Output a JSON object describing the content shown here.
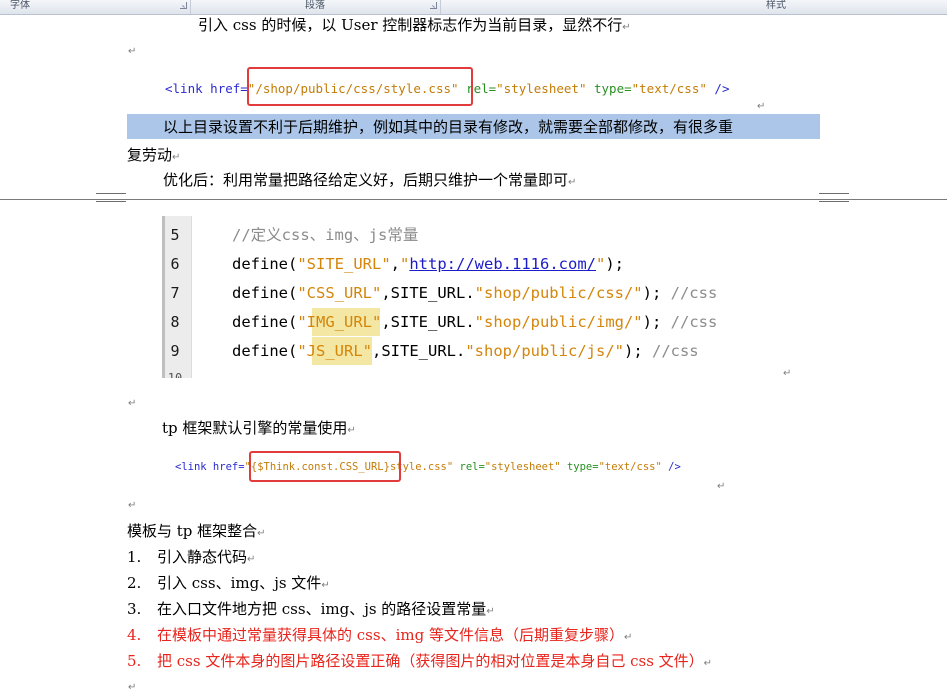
{
  "ribbon": {
    "groups": [
      "字体",
      "段落",
      "样式"
    ]
  },
  "doc": {
    "line_top": "引入 css 的时候，以 User 控制器标志作为当前目录，显然不行",
    "code1": {
      "open": "<link",
      "href_attr": " href=",
      "href_val": "\"/shop/public/css/style.css\"",
      "rel_attr": " rel=",
      "rel_val": "\"stylesheet\"",
      "type_attr": " type=",
      "type_val": "\"text/css\"",
      "close": " />"
    },
    "highlighted_line": "以上目录设置不利于后期维护，例如其中的目录有修改，就需要全部都修改，有很多重",
    "highlighted_cont": "复劳动",
    "optimized": "优化后：利用常量把路径给定义好，后期只维护一个常量即可",
    "code_block": {
      "line_numbers": [
        "5",
        "6",
        "7",
        "8",
        "9"
      ],
      "l5_comment": "//定义css、img、js常量",
      "l6_fn": "define(",
      "l6_str": "\"SITE_URL\"",
      "l6_comma": ",",
      "l6_q1": "\"",
      "l6_url": "http://web.1116.com/",
      "l6_q2": "\"",
      "l6_end": ");",
      "l7_fn": "define(",
      "l7_str": "\"CSS_URL\"",
      "l7_mid": ",SITE_URL.",
      "l7_path": "\"shop/public/css/\"",
      "l7_end": "); ",
      "l7_cmt": "//css",
      "l8_fn": "define(",
      "l8_q1": "\"",
      "l8_name": "IMG_URL",
      "l8_q2": "\"",
      "l8_mid": ",SITE_URL.",
      "l8_path": "\"shop/public/img/\"",
      "l8_end": "); ",
      "l8_cmt": "//css",
      "l9_fn": "define(",
      "l9_q1": "\"",
      "l9_name": "JS_URL",
      "l9_q2": "\"",
      "l9_mid": ",SITE_URL.",
      "l9_path": "\"shop/public/js/\"",
      "l9_end": "); ",
      "l9_cmt": "//css"
    },
    "tp_heading": "tp 框架默认引擎的常量使用",
    "code2": {
      "open": "<link",
      "href_attr": " href=",
      "href_q": "\"",
      "href_val": "{$Think.const.CSS_URL}",
      "href_rest": "style.css\"",
      "rel_attr": " rel=",
      "rel_val": "\"stylesheet\"",
      "type_attr": " type=",
      "type_val": "\"text/css\"",
      "close": " />"
    },
    "integration_heading": "模板与 tp 框架整合",
    "steps": [
      {
        "num": "1.",
        "text": "引入静态代码"
      },
      {
        "num": "2.",
        "text": "引入 css、img、js 文件"
      },
      {
        "num": "3.",
        "text": "在入口文件地方把 css、img、js 的路径设置常量"
      },
      {
        "num": "4.",
        "text": "在模板中通过常量获得具体的 css、img 等文件信息（后期重复步骤）"
      },
      {
        "num": "5.",
        "text": "把 css 文件本身的图片路径设置正确（获得图片的相对位置是本身自己 css 文件）"
      }
    ],
    "para_mark": "↵"
  },
  "colors": {
    "selection": "#abc6e8",
    "annotation_box": "#e23b3b",
    "red_text": "#e8241c",
    "tag_blue": "#2b2bd0",
    "attr_green": "#2a8f22",
    "string_orange": "#c47c08",
    "highlight_yellow": "#f3e7a3"
  }
}
